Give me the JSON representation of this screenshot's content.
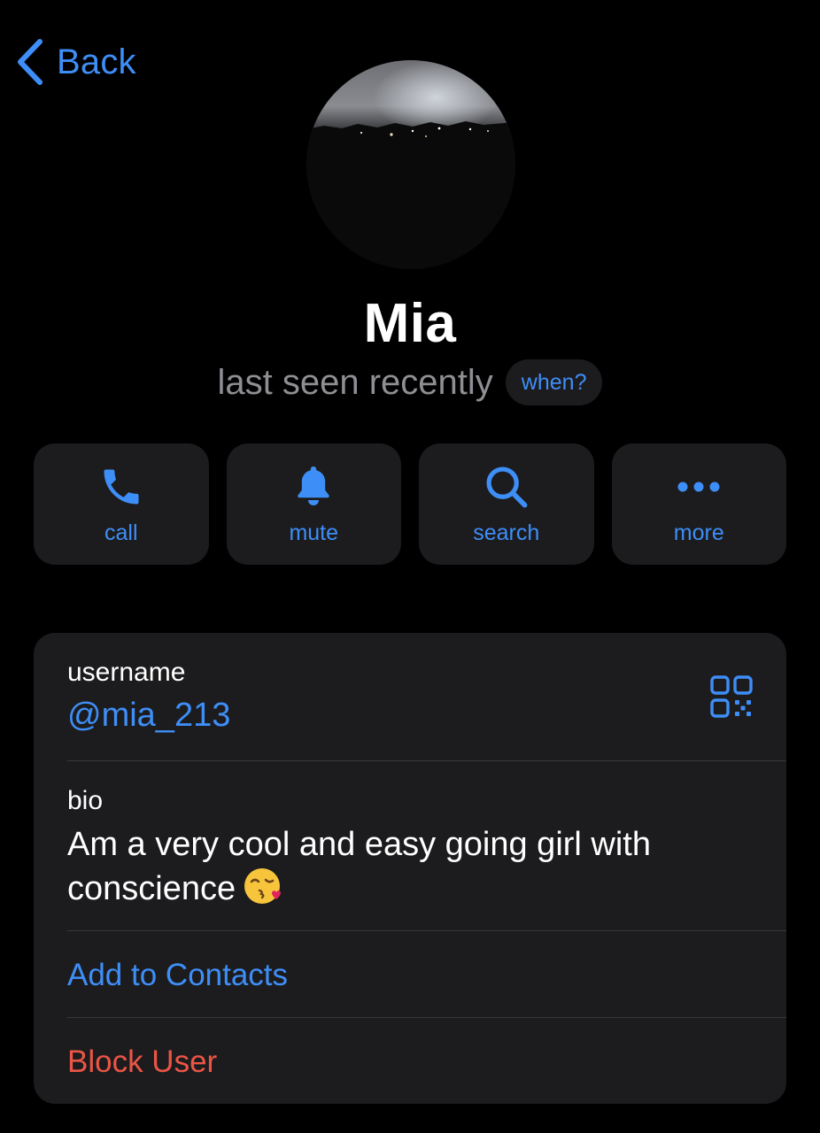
{
  "colors": {
    "accent": "#3e8ef7",
    "danger": "#eb5545",
    "background": "#000000",
    "card": "#1c1c1e",
    "secondary_text": "#8e8e93"
  },
  "nav": {
    "back_label": "Back",
    "back_icon": "chevron-left-icon"
  },
  "profile": {
    "name": "Mia",
    "status": "last seen recently",
    "when_label": "when?"
  },
  "actions": [
    {
      "icon": "phone-icon",
      "label": "call"
    },
    {
      "icon": "bell-icon",
      "label": "mute"
    },
    {
      "icon": "search-icon",
      "label": "search"
    },
    {
      "icon": "ellipsis-icon",
      "label": "more"
    }
  ],
  "info": {
    "username_label": "username",
    "username_value": "@mia_213",
    "qr_icon": "qr-code-icon",
    "bio_label": "bio",
    "bio_text": "Am a very cool and easy going girl with conscience",
    "bio_emoji": "face-blowing-kiss-emoji",
    "add_contact_label": "Add to Contacts",
    "block_label": "Block User"
  }
}
